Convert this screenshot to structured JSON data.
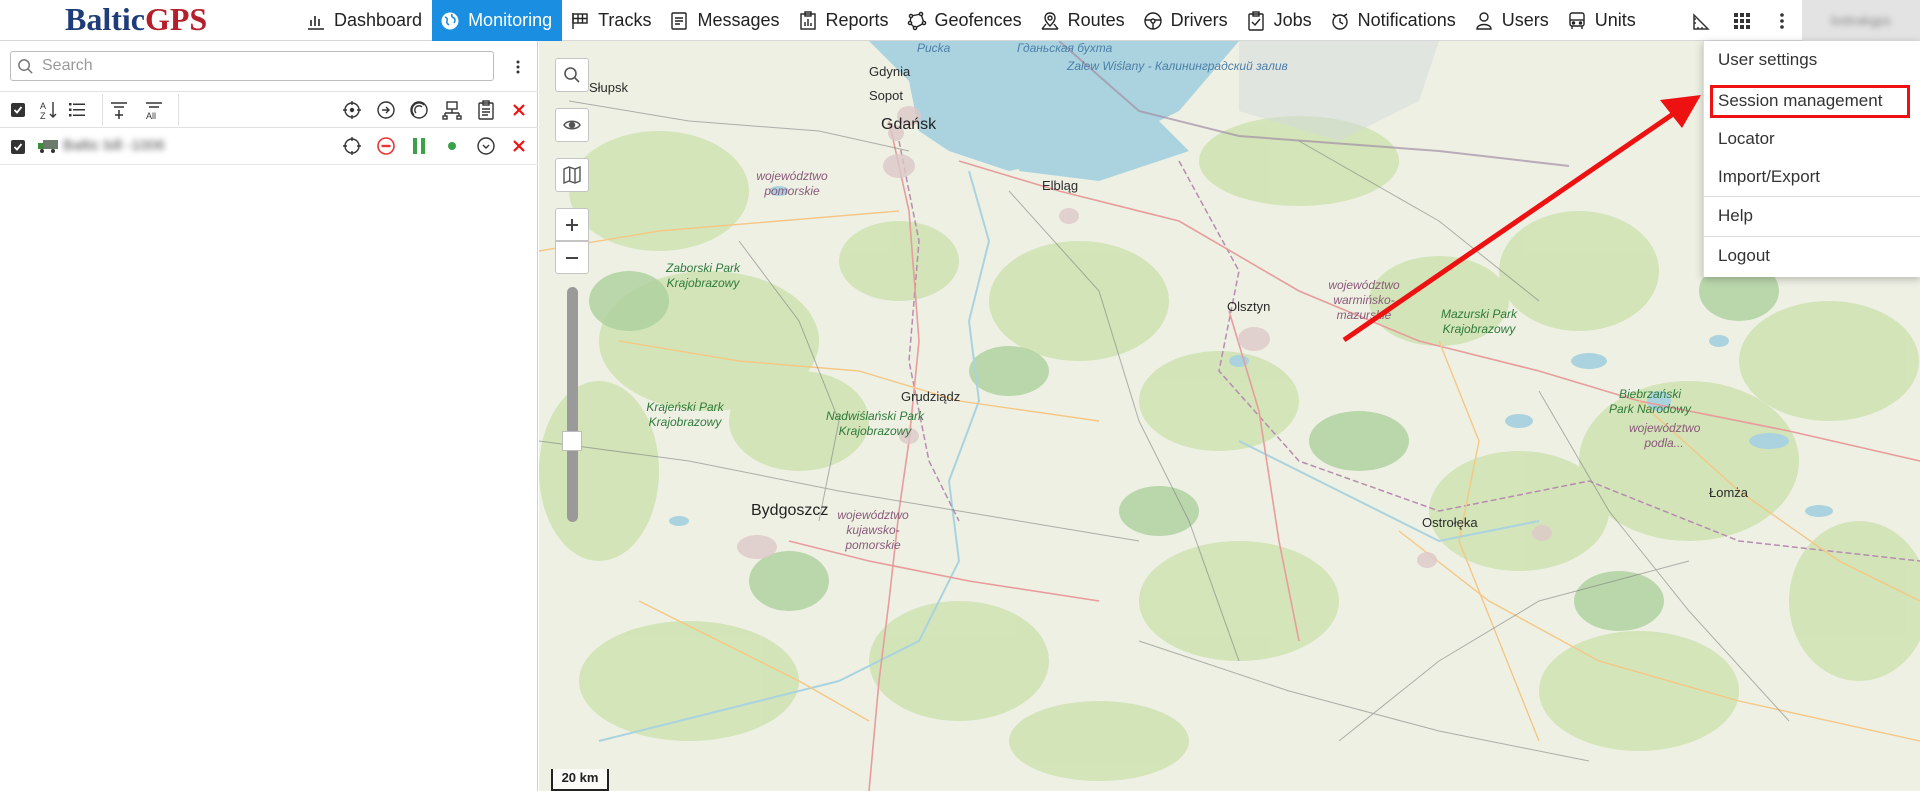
{
  "brand": {
    "part1": "Baltic",
    "part2": "GPS"
  },
  "nav": [
    {
      "label": "Dashboard",
      "icon": "chart-bars-icon",
      "active": false
    },
    {
      "label": "Monitoring",
      "icon": "globe-icon",
      "active": true
    },
    {
      "label": "Tracks",
      "icon": "checkered-flag-icon",
      "active": false
    },
    {
      "label": "Messages",
      "icon": "document-icon",
      "active": false
    },
    {
      "label": "Reports",
      "icon": "report-icon",
      "active": false
    },
    {
      "label": "Geofences",
      "icon": "polygon-icon",
      "active": false
    },
    {
      "label": "Routes",
      "icon": "route-pin-icon",
      "active": false
    },
    {
      "label": "Drivers",
      "icon": "steering-wheel-icon",
      "active": false
    },
    {
      "label": "Jobs",
      "icon": "clipboard-check-icon",
      "active": false
    },
    {
      "label": "Notifications",
      "icon": "alarm-clock-icon",
      "active": false
    },
    {
      "label": "Users",
      "icon": "user-icon",
      "active": false
    },
    {
      "label": "Units",
      "icon": "bus-icon",
      "active": false
    }
  ],
  "account": {
    "name": "bsttrakgps"
  },
  "search": {
    "placeholder": "Search"
  },
  "unit": {
    "name": "Baltic bill -1006",
    "icon": "truck-icon",
    "status_color": "#3aa14a"
  },
  "dropdown": {
    "items": [
      "User settings",
      "Session management",
      "Locator",
      "Import/Export",
      "Help",
      "Logout"
    ],
    "highlighted": "Session management"
  },
  "map": {
    "scale_label": "20 km",
    "labels": {
      "slupsk": "Słupsk",
      "gdynia": "Gdynia",
      "sopot": "Sopot",
      "gdansk": "Gdańsk",
      "elblag": "Elbląg",
      "olsztyn": "Olsztyn",
      "grudziadz": "Grudziądz",
      "bydgoszcz": "Bydgoszcz",
      "lomza": "Łomża",
      "ostroleka": "Ostrołęka",
      "pucka": "Pucka",
      "gdanska_bay": "Гданьская бухта",
      "vistula_lagoon": "Zalew Wiślany - Калининградский залив",
      "pomorskie": "województwo pomorskie",
      "zaborski": "Zaborski Park Krajobrazowy",
      "krajenski": "Krajeński Park Krajobrazowy",
      "nadwislanski": "Nadwiślański Park Krajobrazowy",
      "kujawsko": "województwo kujawsko-pomorskie",
      "warminsko": "województwo warmińsko-mazurskie",
      "mazurski": "Mazurski Park Krajobrazowy",
      "biebrzanski": "Biebrzański Park Narodowy",
      "podlaskie": "województwo podla..."
    }
  },
  "colors": {
    "accent": "#1a8ee1",
    "highlight": "#e11111"
  }
}
